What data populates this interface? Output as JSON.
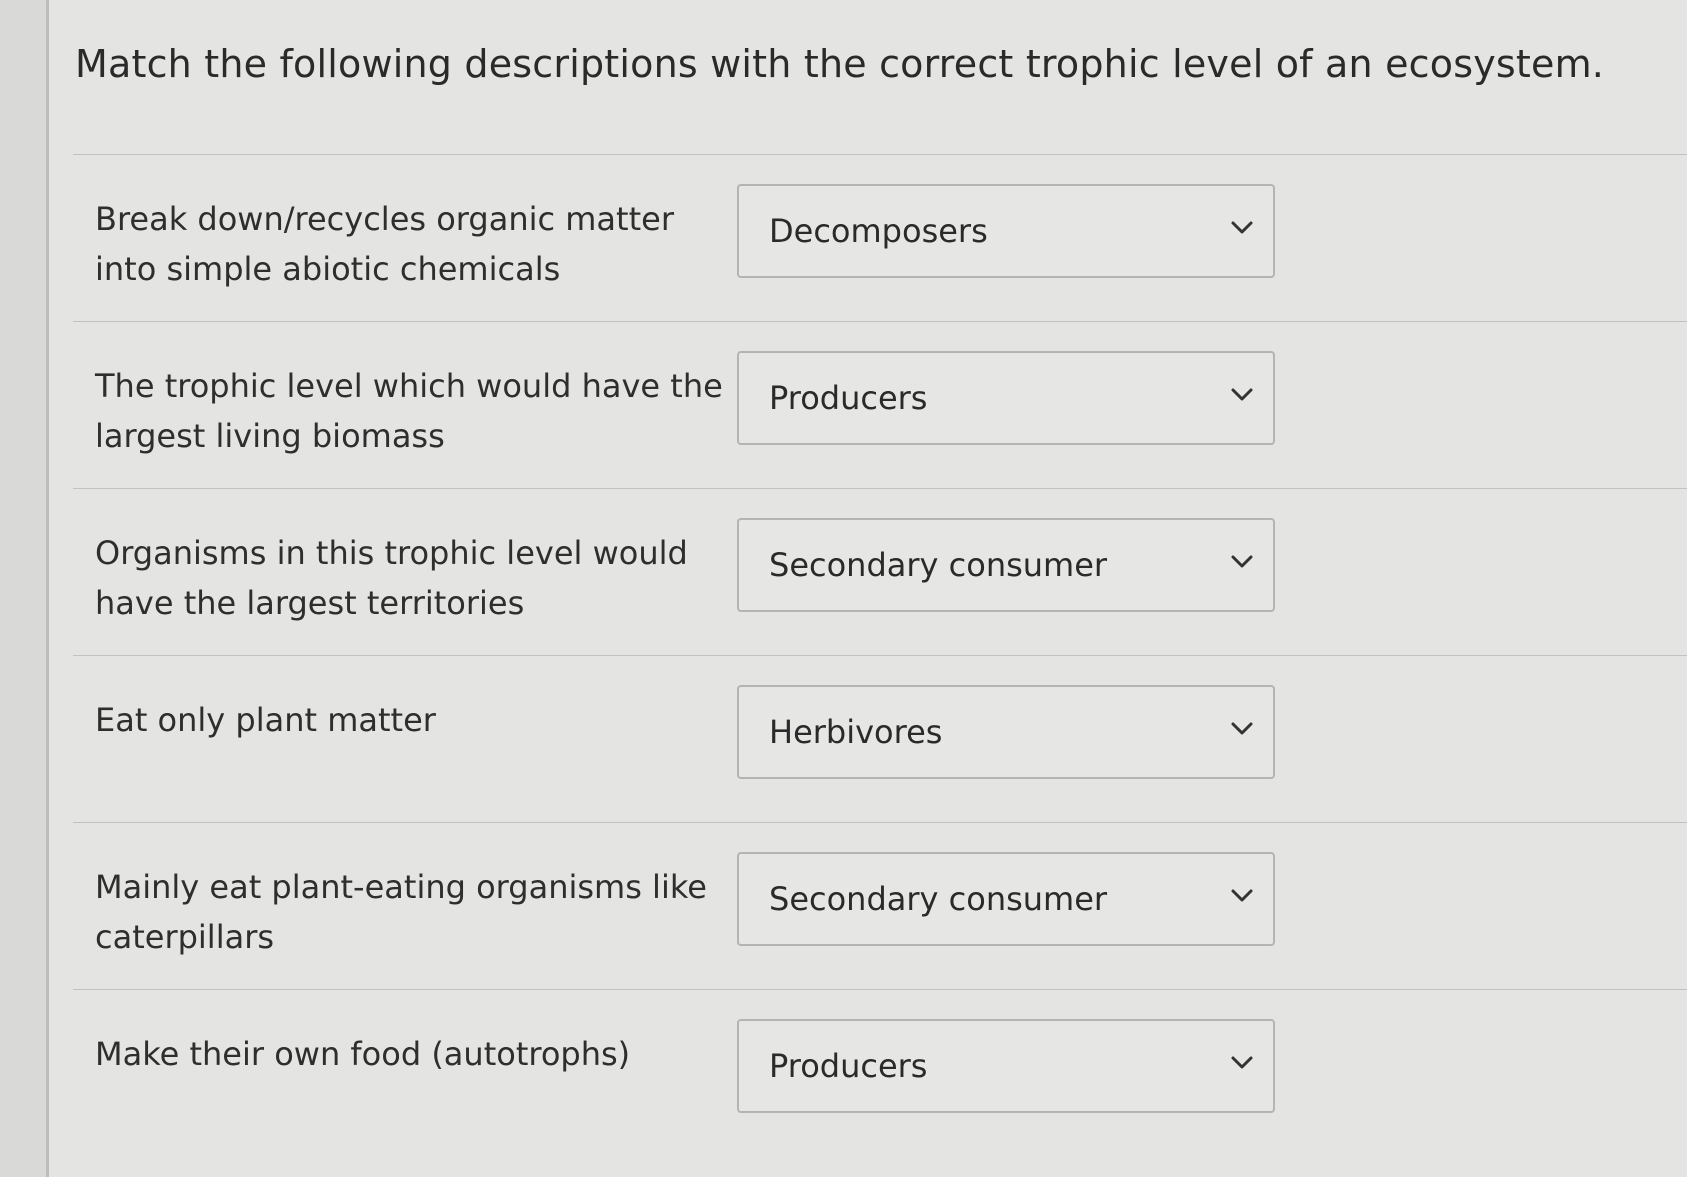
{
  "question": {
    "title": "Match the following descriptions with the correct trophic level of an ecosystem."
  },
  "items": [
    {
      "prompt": "Break down/recycles organic matter into simple abiotic chemicals",
      "selected": "Decomposers"
    },
    {
      "prompt": "The trophic level which would have the largest living biomass",
      "selected": "Producers"
    },
    {
      "prompt": "Organisms in this trophic level would have the largest territories",
      "selected": "Secondary consumer"
    },
    {
      "prompt": "Eat only plant matter",
      "selected": "Herbivores"
    },
    {
      "prompt": "Mainly eat plant-eating organisms like caterpillars",
      "selected": "Secondary consumer"
    },
    {
      "prompt": "Make their own food (autotrophs)",
      "selected": "Producers"
    }
  ],
  "icons": {
    "dropdown": "chevron-down-icon"
  },
  "colors": {
    "background": "#e4e4e2",
    "text": "#2b2b2b",
    "border": "#b4b4b2"
  }
}
